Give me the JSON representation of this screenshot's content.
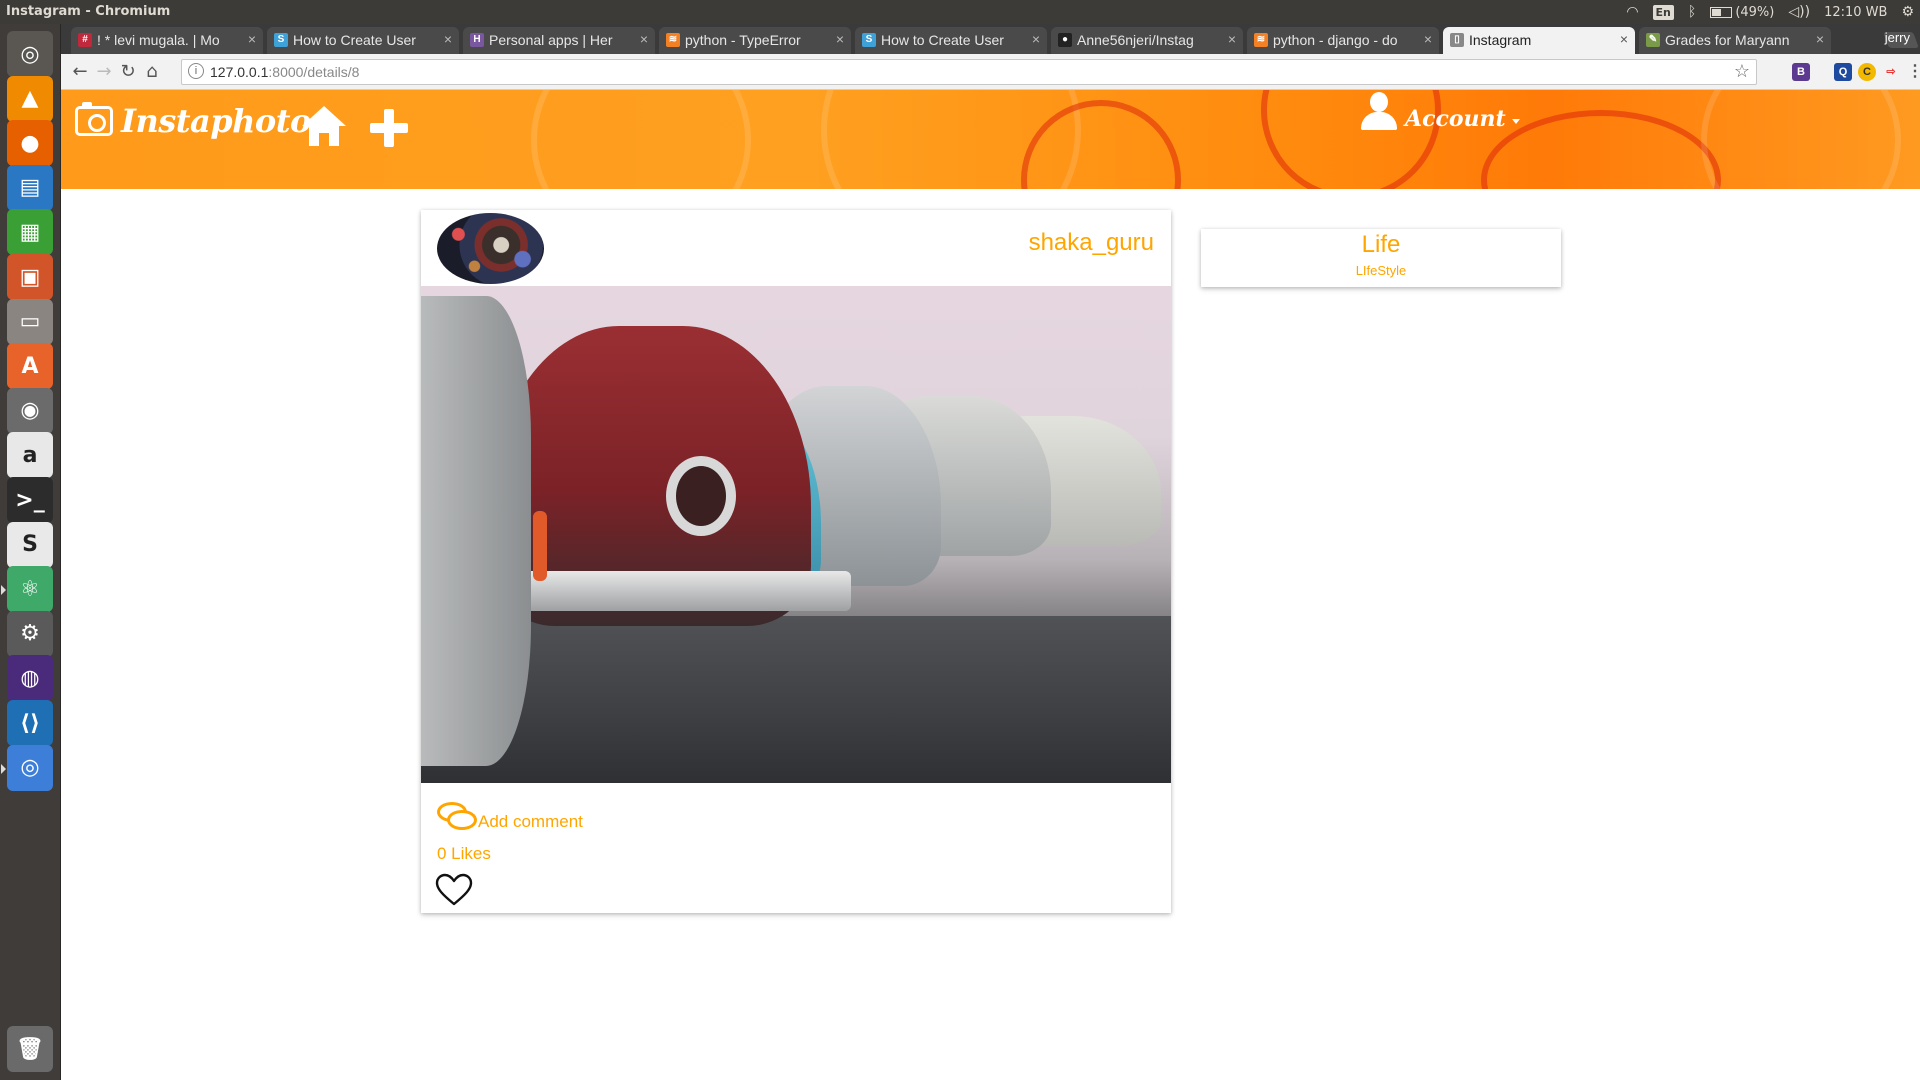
{
  "os": {
    "window_title": "Instagram - Chromium",
    "keyboard_layout": "En",
    "battery": "(49%)",
    "battery_level": 0.49,
    "clock": "12:10 WB"
  },
  "launcher": [
    {
      "name": "ubuntu-dash-icon",
      "glyph": "◎",
      "bg": "#5a5652"
    },
    {
      "name": "vlc-icon",
      "glyph": "▲",
      "bg": "#f08a00"
    },
    {
      "name": "firefox-icon",
      "glyph": "●",
      "bg": "#e66000"
    },
    {
      "name": "libreoffice-writer-icon",
      "glyph": "▤",
      "bg": "#2a78c4"
    },
    {
      "name": "libreoffice-calc-icon",
      "glyph": "▦",
      "bg": "#3aa035"
    },
    {
      "name": "libreoffice-impress-icon",
      "glyph": "▣",
      "bg": "#d2552a"
    },
    {
      "name": "files-icon",
      "glyph": "▭",
      "bg": "#8a8580"
    },
    {
      "name": "software-center-icon",
      "glyph": "A",
      "bg": "#e8632a"
    },
    {
      "name": "disk-icon",
      "glyph": "◉",
      "bg": "#6b6b6b"
    },
    {
      "name": "amazon-icon",
      "glyph": "a",
      "bg": "#e8e8e8"
    },
    {
      "name": "terminal-icon",
      "glyph": ">_",
      "bg": "#2c2c2c"
    },
    {
      "name": "slack-icon",
      "glyph": "S",
      "bg": "#e9e9e9"
    },
    {
      "name": "atom-icon",
      "glyph": "⚛",
      "bg": "#3fa96a"
    },
    {
      "name": "system-settings-icon",
      "glyph": "⚙",
      "bg": "#5a5a5a"
    },
    {
      "name": "eclipse-icon",
      "glyph": "◍",
      "bg": "#4a2a7a"
    },
    {
      "name": "vscode-icon",
      "glyph": "⟨⟩",
      "bg": "#1f6fb5"
    },
    {
      "name": "chromium-icon",
      "glyph": "◎",
      "bg": "#3d7fd8"
    },
    {
      "name": "trash-icon",
      "glyph": "🗑",
      "bg": "#6a6a6a"
    }
  ],
  "browser": {
    "tabs": [
      {
        "title": "! * levi mugala. | Mo",
        "fav": "#",
        "fav_bg": "#c0283c"
      },
      {
        "title": "How to Create User",
        "fav": "S",
        "fav_bg": "#3ea1d8"
      },
      {
        "title": "Personal apps | Her",
        "fav": "H",
        "fav_bg": "#79589f"
      },
      {
        "title": "python - TypeError",
        "fav": "≋",
        "fav_bg": "#f48024"
      },
      {
        "title": "How to Create User",
        "fav": "S",
        "fav_bg": "#3ea1d8"
      },
      {
        "title": "Anne56njeri/Instag",
        "fav": "●",
        "fav_bg": "#222222"
      },
      {
        "title": "python - django - do",
        "fav": "≋",
        "fav_bg": "#f48024"
      },
      {
        "title": "Instagram",
        "fav": "▯",
        "fav_bg": "#888888",
        "active": true
      },
      {
        "title": "Grades for Maryann",
        "fav": "✎",
        "fav_bg": "#7a9a4a"
      }
    ],
    "profile": "jerry",
    "url_host": "127.0.0.1",
    "url_rest": ":8000/details/8"
  },
  "site": {
    "brand": "Instaphoto",
    "account_label": "Account",
    "accent": "#ffa500",
    "post": {
      "username": "shaka_guru",
      "comment_label": "Add comment",
      "likes": "0 Likes"
    },
    "category": {
      "name": "Life",
      "subtitle": "LIfeStyle"
    }
  }
}
